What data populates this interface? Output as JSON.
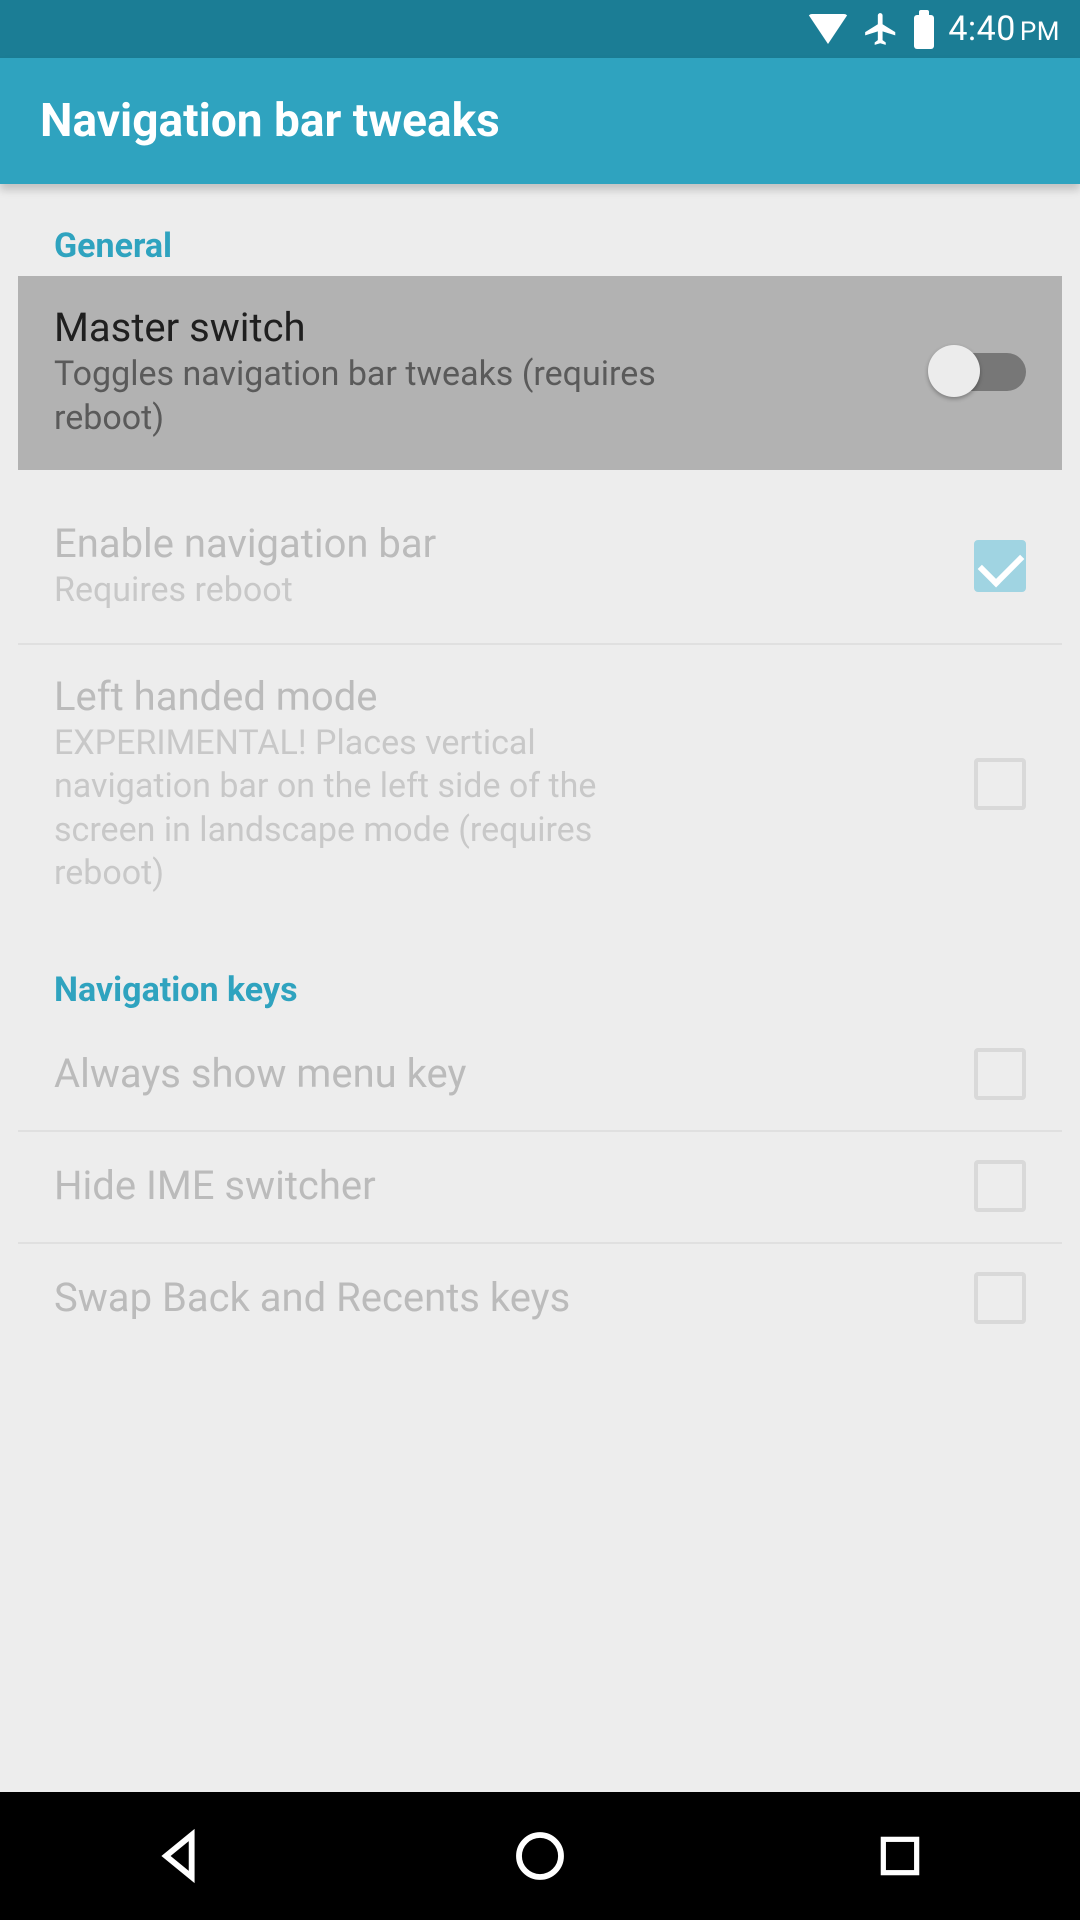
{
  "statusBar": {
    "time": "4:40",
    "ampm": "PM"
  },
  "appBar": {
    "title": "Navigation bar tweaks"
  },
  "sections": {
    "general": {
      "header": "General",
      "masterSwitch": {
        "title": "Master switch",
        "subtitle": "Toggles navigation bar tweaks (requires reboot)"
      },
      "enableNav": {
        "title": "Enable navigation bar",
        "subtitle": "Requires reboot"
      },
      "leftHanded": {
        "title": "Left handed mode",
        "subtitle": "EXPERIMENTAL! Places vertical navigation bar on the left side of the screen in landscape mode (requires reboot)"
      }
    },
    "navKeys": {
      "header": "Navigation keys",
      "showMenu": {
        "title": "Always show menu key"
      },
      "hideIme": {
        "title": "Hide IME switcher"
      },
      "swapBack": {
        "title": "Swap Back and Recents keys"
      }
    }
  }
}
